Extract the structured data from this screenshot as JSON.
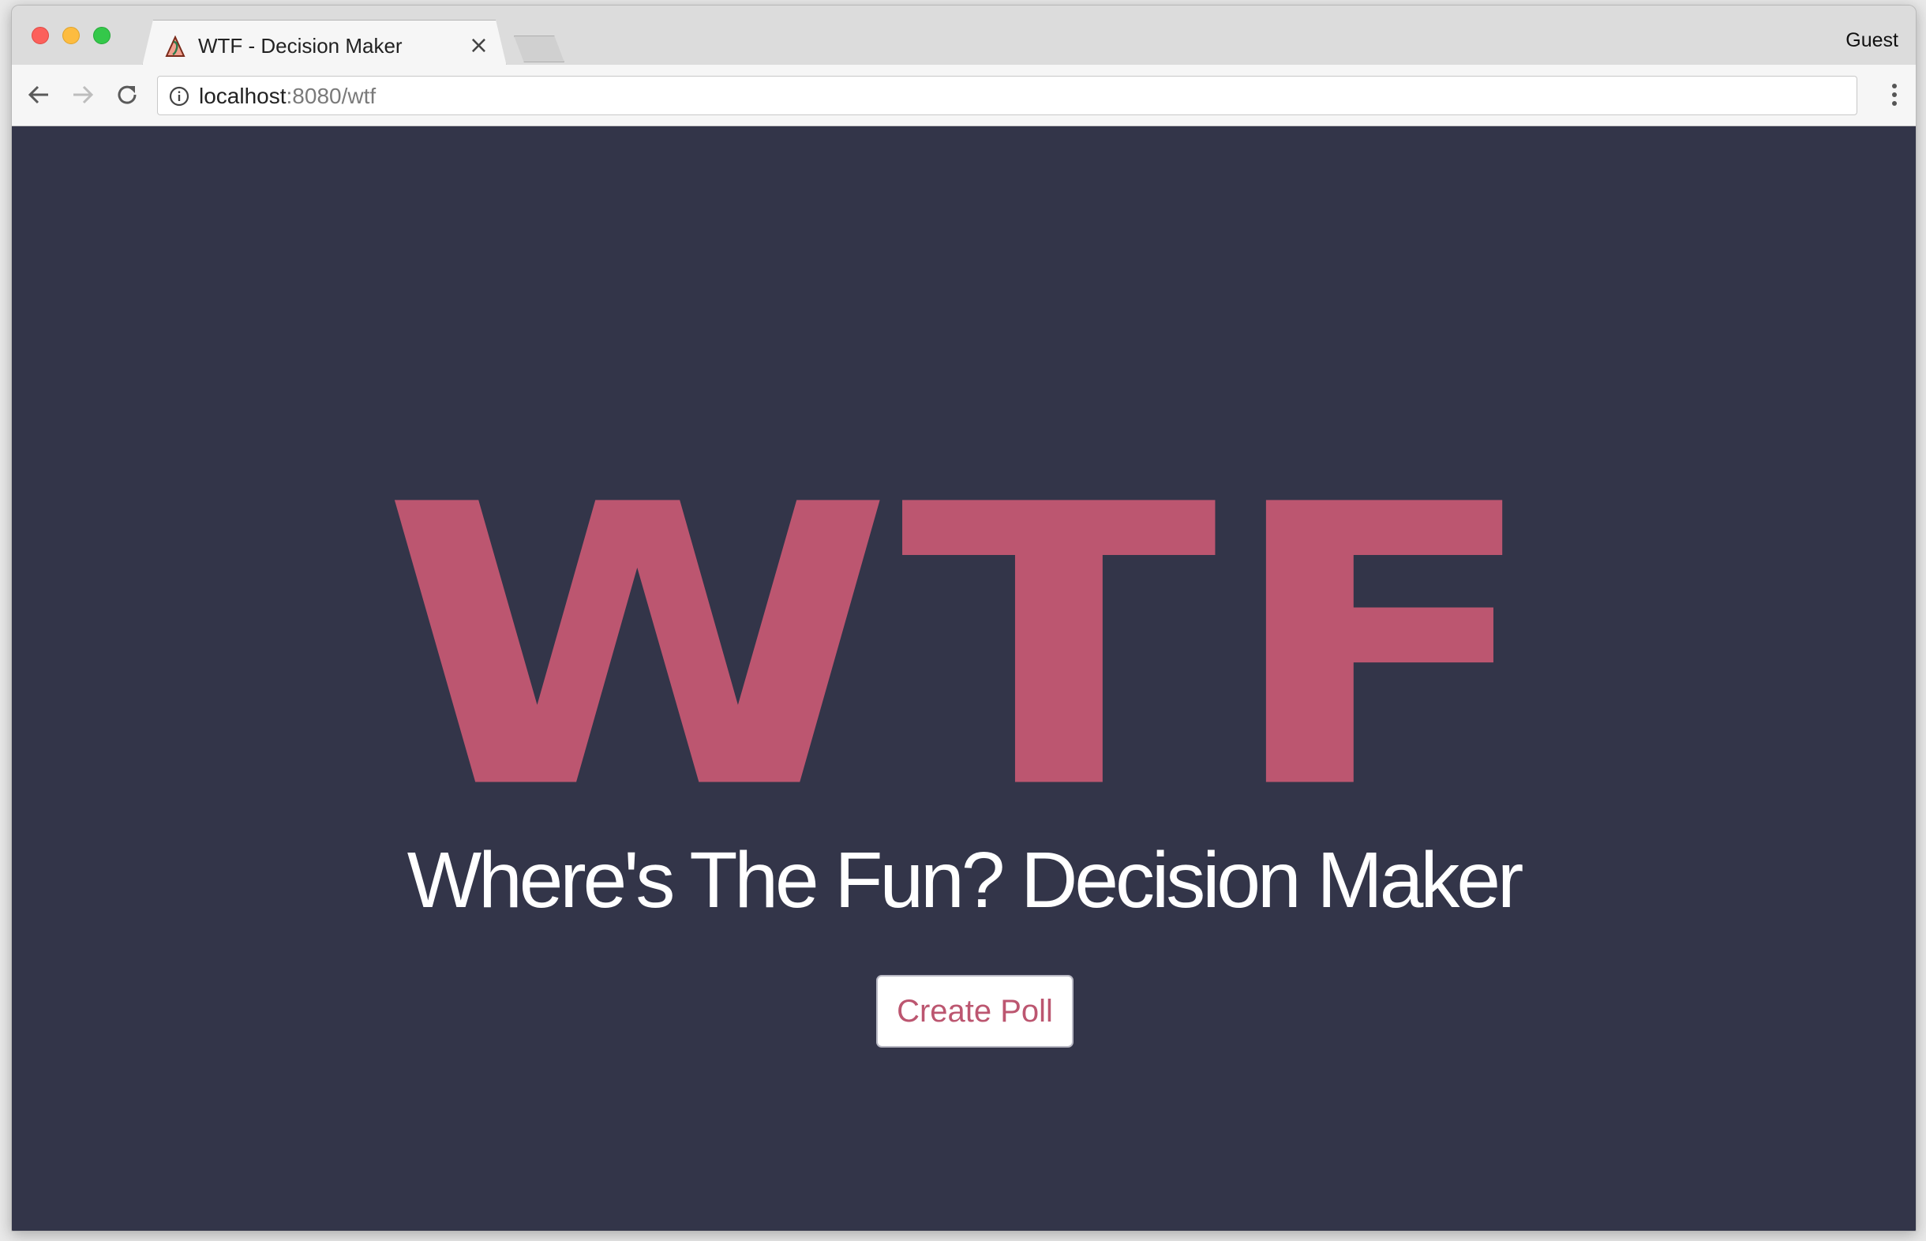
{
  "browser": {
    "tab_title": "WTF - Decision Maker",
    "tab_close": "×",
    "profile": "Guest",
    "url_host": "localhost",
    "url_rest": ":8080/wtf"
  },
  "page": {
    "logo_text": "WTF",
    "subtitle": "Where's The Fun? Decision Maker",
    "create_button_label": "Create Poll"
  },
  "colors": {
    "page_background": "#333549",
    "accent": "#bc5670",
    "subtitle_text": "#ffffff"
  }
}
